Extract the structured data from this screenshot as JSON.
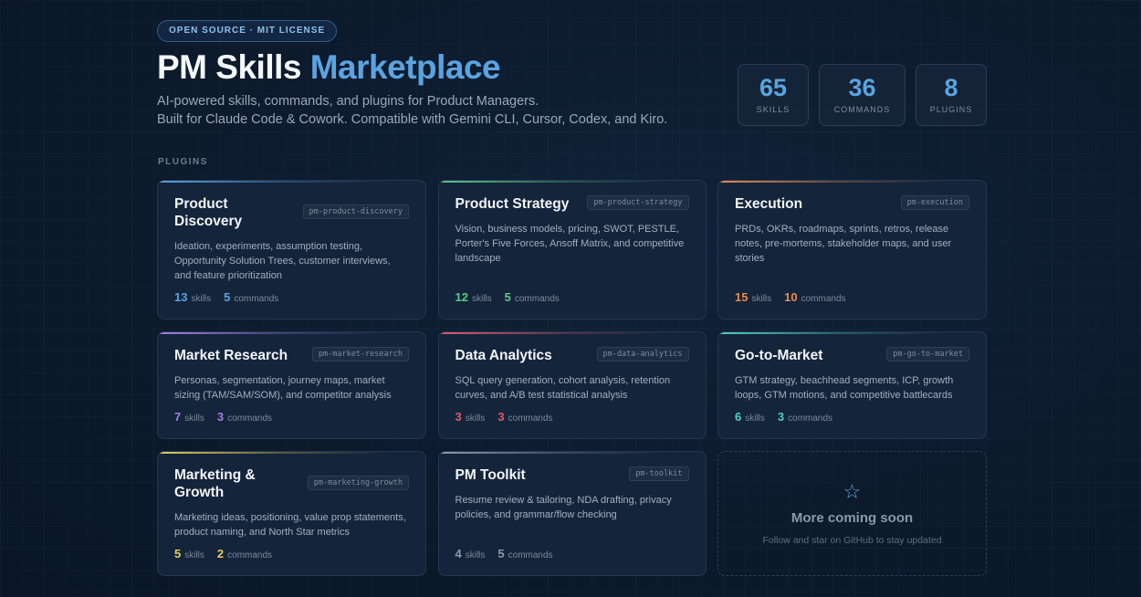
{
  "header": {
    "badge": "OPEN SOURCE · MIT LICENSE",
    "title_main": "PM Skills",
    "title_accent": "Marketplace",
    "subtitle_1": "AI-powered skills, commands, and plugins for Product Managers.",
    "subtitle_2": "Built for Claude Code & Cowork. Compatible with Gemini CLI, Cursor, Codex, and Kiro."
  },
  "stats": [
    {
      "value": "65",
      "label": "SKILLS"
    },
    {
      "value": "36",
      "label": "COMMANDS"
    },
    {
      "value": "8",
      "label": "PLUGINS"
    }
  ],
  "section_label": "PLUGINS",
  "count_labels": {
    "skills": "skills",
    "commands": "commands"
  },
  "plugins": [
    {
      "name": "Product Discovery",
      "tag": "pm-product-discovery",
      "desc": "Ideation, experiments, assumption testing, Opportunity Solution Trees, customer interviews, and feature prioritization",
      "skills": "13",
      "commands": "5",
      "color": "#5ba3e0"
    },
    {
      "name": "Product Strategy",
      "tag": "pm-product-strategy",
      "desc": "Vision, business models, pricing, SWOT, PESTLE, Porter's Five Forces, Ansoff Matrix, and competitive landscape",
      "skills": "12",
      "commands": "5",
      "color": "#5cc98a"
    },
    {
      "name": "Execution",
      "tag": "pm-execution",
      "desc": "PRDs, OKRs, roadmaps, sprints, retros, release notes, pre-mortems, stakeholder maps, and user stories",
      "skills": "15",
      "commands": "10",
      "color": "#e88a4e"
    },
    {
      "name": "Market Research",
      "tag": "pm-market-research",
      "desc": "Personas, segmentation, journey maps, market sizing (TAM/SAM/SOM), and competitor analysis",
      "skills": "7",
      "commands": "3",
      "color": "#a47ee8"
    },
    {
      "name": "Data Analytics",
      "tag": "pm-data-analytics",
      "desc": "SQL query generation, cohort analysis, retention curves, and A/B test statistical analysis",
      "skills": "3",
      "commands": "3",
      "color": "#e05a6f"
    },
    {
      "name": "Go-to-Market",
      "tag": "pm-go-to-market",
      "desc": "GTM strategy, beachhead segments, ICP, growth loops, GTM motions, and competitive battlecards",
      "skills": "6",
      "commands": "3",
      "color": "#4fd1c0"
    },
    {
      "name": "Marketing & Growth",
      "tag": "pm-marketing-growth",
      "desc": "Marketing ideas, positioning, value prop statements, product naming, and North Star metrics",
      "skills": "5",
      "commands": "2",
      "color": "#e6cc5c"
    },
    {
      "name": "PM Toolkit",
      "tag": "pm-toolkit",
      "desc": "Resume review & tailoring, NDA drafting, privacy policies, and grammar/flow checking",
      "skills": "4",
      "commands": "5",
      "color": "#8c9aab"
    }
  ],
  "coming_soon": {
    "icon": "star-icon",
    "title": "More coming soon",
    "subtitle": "Follow and star on GitHub to stay updated"
  }
}
